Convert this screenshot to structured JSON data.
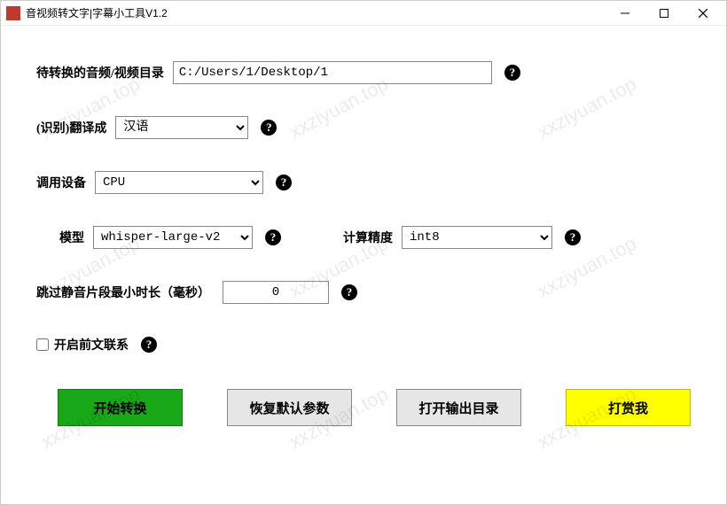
{
  "window": {
    "title": "音视频转文字|字幕小工具V1.2"
  },
  "directory": {
    "label": "待转换的音频/视频目录",
    "value": "C:/Users/1/Desktop/1"
  },
  "language": {
    "label": "(识别)翻译成",
    "value": "汉语"
  },
  "device": {
    "label": "调用设备",
    "value": "CPU"
  },
  "model": {
    "label": "模型",
    "value": "whisper-large-v2"
  },
  "precision": {
    "label": "计算精度",
    "value": "int8"
  },
  "silence": {
    "label": "跳过静音片段最小时长（毫秒）",
    "value": "0"
  },
  "context": {
    "label": "开启前文联系",
    "checked": false
  },
  "buttons": {
    "start": "开始转换",
    "reset": "恢复默认参数",
    "open_output": "打开输出目录",
    "donate": "打赏我"
  },
  "watermark": "xxziyuan.top"
}
